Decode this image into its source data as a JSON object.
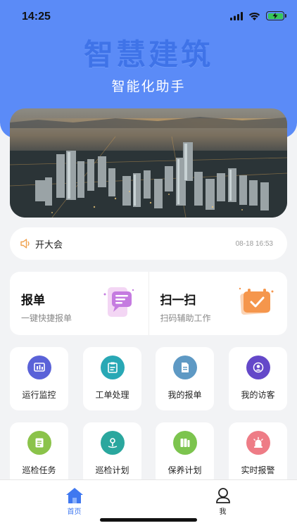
{
  "status_bar": {
    "time": "14:25"
  },
  "header": {
    "title": "智慧建筑",
    "subtitle": "智能化助手"
  },
  "notice": {
    "text": "开大会",
    "time": "08-18 16:53"
  },
  "quick_actions": [
    {
      "title": "报单",
      "desc": "一键快捷报单",
      "icon": "chat-bubble-icon"
    },
    {
      "title": "扫一扫",
      "desc": "扫码辅助工作",
      "icon": "calendar-check-icon"
    }
  ],
  "grid": [
    {
      "label": "运行监控",
      "icon": "monitor-icon",
      "color": "#5a62d8"
    },
    {
      "label": "工单处理",
      "icon": "work-order-icon",
      "color": "#29a8b5"
    },
    {
      "label": "我的报单",
      "icon": "document-icon",
      "color": "#5e99c4"
    },
    {
      "label": "我的访客",
      "icon": "visitor-icon",
      "color": "#6448c9"
    },
    {
      "label": "巡检任务",
      "icon": "inspection-task-icon",
      "color": "#8bc34a"
    },
    {
      "label": "巡检计划",
      "icon": "location-plan-icon",
      "color": "#2aa79e"
    },
    {
      "label": "保养计划",
      "icon": "maintenance-icon",
      "color": "#7cc44e"
    },
    {
      "label": "实时报警",
      "icon": "alarm-icon",
      "color": "#ee7c86"
    }
  ],
  "tabbar": {
    "home": "首页",
    "me": "我",
    "active_color": "#3f78f0"
  }
}
